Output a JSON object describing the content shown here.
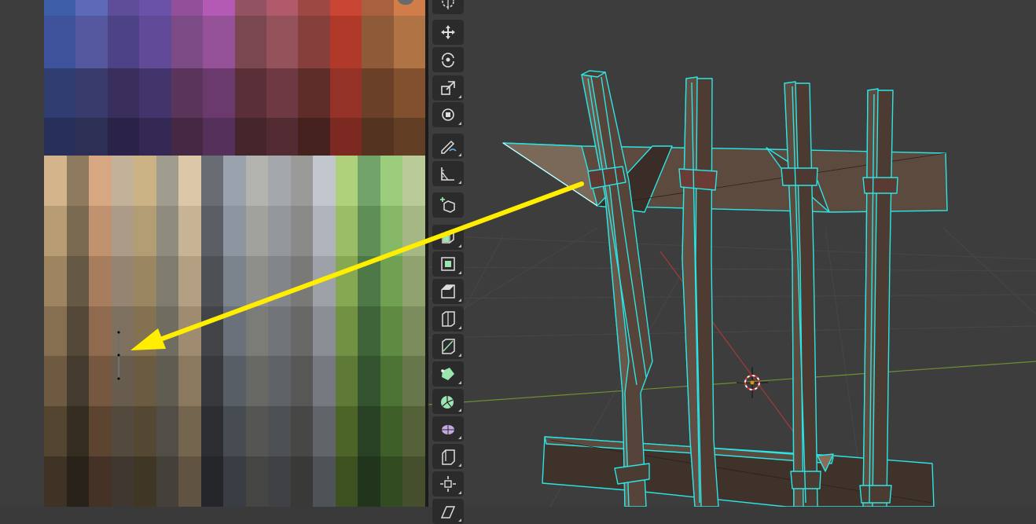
{
  "app": "Blender",
  "uv_editor": {
    "palette": {
      "rows": 10,
      "cols": 18,
      "top_block_colors": [
        [
          "#3f5ea8",
          "#5d6ab8",
          "#5e4e9a",
          "#6a52a8",
          "#92509b",
          "#b45ab5",
          "#925262",
          "#b05a6c",
          "#9e4843",
          "#c84633",
          "#a9603f",
          "#d07d4a"
        ],
        [
          "#3f539c",
          "#55589e",
          "#4e4286",
          "#614a98",
          "#7c4a84",
          "#965298",
          "#7a4650",
          "#94525b",
          "#873f3b",
          "#b0392a",
          "#8e5a38",
          "#b07444"
        ],
        [
          "#2f3d70",
          "#393b6c",
          "#3a2e5c",
          "#43356c",
          "#5a345a",
          "#6a3a6c",
          "#5b2f38",
          "#6e3942",
          "#5e2c29",
          "#943227",
          "#6b4028",
          "#80502f"
        ],
        [
          "#27305a",
          "#2e2f55",
          "#2a2347",
          "#342955",
          "#452944",
          "#54305a",
          "#46262c",
          "#532c33",
          "#46221f",
          "#7c2a21",
          "#543320",
          "#613e24"
        ]
      ],
      "bottom_block_colors": [
        [
          "#d3b48b",
          "#8d7a5f",
          "#d7a782",
          "#c4b19a",
          "#cbb386",
          "#a09c8e",
          "#dcc8a8",
          "#696c72",
          "#9aa3ad",
          "#b3b3b0",
          "#a4a7ac",
          "#9a9a99",
          "#c2c6ce",
          "#b0d17c",
          "#72a36a",
          "#9ccd7c",
          "#bacb97"
        ],
        [
          "#b89c74",
          "#7a6a52",
          "#c09270",
          "#ac9b86",
          "#b39d74",
          "#8f8b7e",
          "#c7b494",
          "#5b5e64",
          "#8d96a0",
          "#a1a19e",
          "#94979c",
          "#8a8a89",
          "#b0b4bc",
          "#9bbd66",
          "#5f8e57",
          "#86b766",
          "#a5b783"
        ],
        [
          "#9e8560",
          "#655844",
          "#a87d5e",
          "#948471",
          "#9b8662",
          "#7f7b6e",
          "#b39f81",
          "#4d5055",
          "#7b838c",
          "#8e8e8b",
          "#82858a",
          "#797978",
          "#9da1a8",
          "#86a853",
          "#4e7847",
          "#70a051",
          "#90a26e"
        ],
        [
          "#866f50",
          "#544838",
          "#8f6a4e",
          "#7e705f",
          "#837151",
          "#6f6c60",
          "#9f8c70",
          "#424448",
          "#6a717a",
          "#7b7b78",
          "#717478",
          "#686867",
          "#8a8e95",
          "#729143",
          "#40643a",
          "#5e8a42",
          "#7c8c5c"
        ],
        [
          "#6d5a40",
          "#443a2d",
          "#76573f",
          "#685c4e",
          "#6b5c41",
          "#5f5c52",
          "#8a795f",
          "#37393c",
          "#585e66",
          "#686865",
          "#5f6266",
          "#575756",
          "#767a80",
          "#5f7a36",
          "#34532f",
          "#4e7435",
          "#68764b"
        ],
        [
          "#544530",
          "#352d22",
          "#5c4431",
          "#53493d",
          "#544832",
          "#504e46",
          "#74654e",
          "#2d2e31",
          "#474c53",
          "#555553",
          "#4e5154",
          "#474746",
          "#61656a",
          "#4d6429",
          "#294225",
          "#3f5f29",
          "#556139"
        ],
        [
          "#3e3324",
          "#28221a",
          "#443226",
          "#403830",
          "#3f3626",
          "#43413a",
          "#605342",
          "#25262a",
          "#3a3e44",
          "#454543",
          "#3f4144",
          "#393938",
          "#4f5257",
          "#3d5020",
          "#21351d",
          "#324b20",
          "#454f2e"
        ]
      ]
    }
  },
  "viewport": {
    "background": "#3d3d3d",
    "wire_color": "#29e6e6",
    "surface_color": "#5c4a3e",
    "x_axis_color": "#a33a3a",
    "y_axis_color": "#6f8f32"
  },
  "toolbar": {
    "tools": [
      {
        "name": "cursor-icon",
        "active": false
      },
      {
        "name": "move-icon",
        "active": false
      },
      {
        "name": "rotate-icon",
        "active": false
      },
      {
        "name": "scale-icon",
        "active": false
      },
      {
        "name": "transform-icon",
        "active": false
      },
      {
        "name": "annotate-icon",
        "active": false
      },
      {
        "name": "measure-icon",
        "active": false
      },
      {
        "name": "add-cube-icon",
        "active": false
      },
      {
        "name": "extrude-region-icon",
        "active": false
      },
      {
        "name": "inset-faces-icon",
        "active": false
      },
      {
        "name": "bevel-icon",
        "active": false
      },
      {
        "name": "loop-cut-icon",
        "active": false
      },
      {
        "name": "knife-icon",
        "active": false
      },
      {
        "name": "poly-build-icon",
        "active": false
      },
      {
        "name": "spin-icon",
        "active": false
      },
      {
        "name": "smooth-icon",
        "active": false
      },
      {
        "name": "edge-slide-icon",
        "active": false
      },
      {
        "name": "shrink-fatten-icon",
        "active": false
      },
      {
        "name": "shear-icon",
        "active": false
      }
    ]
  },
  "annotation": {
    "arrow_color": "#ffee00"
  }
}
